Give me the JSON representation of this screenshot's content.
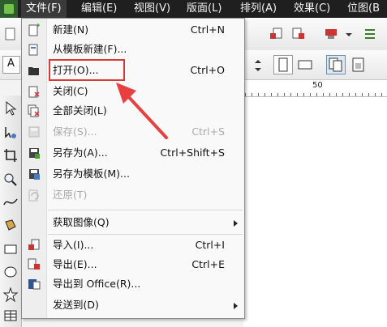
{
  "menubar": {
    "items": [
      {
        "label": "文件(F)"
      },
      {
        "label": "编辑(E)"
      },
      {
        "label": "视图(V)"
      },
      {
        "label": "版面(L)"
      },
      {
        "label": "排列(A)"
      },
      {
        "label": "效果(C)"
      },
      {
        "label": "位图(B"
      }
    ]
  },
  "file_menu": {
    "items": [
      {
        "label": "新建(N)",
        "shortcut": "Ctrl+N",
        "icon": "new-document-icon",
        "enabled": true
      },
      {
        "label": "从模板新建(F)...",
        "shortcut": "",
        "icon": "new-from-template-icon",
        "enabled": true
      },
      {
        "label": "打开(O)...",
        "shortcut": "Ctrl+O",
        "icon": "open-folder-icon",
        "enabled": true
      },
      {
        "label": "关闭(C)",
        "shortcut": "",
        "icon": "close-document-icon",
        "enabled": true
      },
      {
        "label": "全部关闭(L)",
        "shortcut": "",
        "icon": "close-all-icon",
        "enabled": true
      },
      {
        "label": "保存(S)...",
        "shortcut": "Ctrl+S",
        "icon": "save-icon",
        "enabled": false
      },
      {
        "label": "另存为(A)...",
        "shortcut": "Ctrl+Shift+S",
        "icon": "save-as-icon",
        "enabled": true
      },
      {
        "label": "另存为模板(M)...",
        "shortcut": "",
        "icon": "save-as-template-icon",
        "enabled": true
      },
      {
        "label": "还原(T)",
        "shortcut": "",
        "icon": "revert-icon",
        "enabled": false
      },
      {
        "label": "获取图像(Q)",
        "shortcut": "",
        "icon": "",
        "enabled": true,
        "submenu": true
      },
      {
        "label": "导入(I)...",
        "shortcut": "Ctrl+I",
        "icon": "import-icon",
        "enabled": true
      },
      {
        "label": "导出(E)...",
        "shortcut": "Ctrl+E",
        "icon": "export-icon",
        "enabled": true
      },
      {
        "label": "导出到 Office(R)...",
        "shortcut": "",
        "icon": "export-office-icon",
        "enabled": true
      },
      {
        "label": "发送到(D)",
        "shortcut": "",
        "icon": "",
        "enabled": true,
        "submenu": true
      }
    ]
  },
  "ruler": {
    "label": "50"
  },
  "colors": {
    "highlight": "#d83a36",
    "menubar": "#1f1f1f",
    "arrow": "#e84040"
  }
}
